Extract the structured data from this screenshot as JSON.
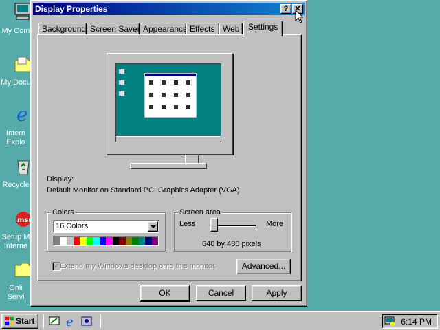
{
  "desktop": {
    "icons": [
      {
        "label": "My Com",
        "icon": "my-computer-icon"
      },
      {
        "label": "My Docu",
        "icon": "folder-icon"
      },
      {
        "label": "Intern",
        "label2": "Explo",
        "icon": "internet-explorer-icon"
      },
      {
        "label": "Recycle",
        "icon": "recycle-bin-icon"
      },
      {
        "label": "Setup M",
        "label2": "Interne",
        "icon": "msn-icon"
      },
      {
        "label": "Onli",
        "label2": "Servi",
        "icon": "folder-icon"
      }
    ]
  },
  "dialog": {
    "title": "Display Properties",
    "help_button": "?",
    "close_button": "✕",
    "tabs": [
      "Background",
      "Screen Saver",
      "Appearance",
      "Effects",
      "Web",
      "Settings"
    ],
    "active_tab": "Settings",
    "display_label": "Display:",
    "display_value": "Default Monitor on Standard PCI Graphics Adapter (VGA)",
    "colors": {
      "group_label": "Colors",
      "selected": "16 Colors",
      "palette": [
        "#808080",
        "#ffffff",
        "#c0c0c0",
        "#ff0000",
        "#ffff00",
        "#00ff00",
        "#00ffff",
        "#0000ff",
        "#ff00ff",
        "#000000",
        "#800000",
        "#808000",
        "#008000",
        "#008080",
        "#000080",
        "#800080"
      ]
    },
    "screen_area": {
      "group_label": "Screen area",
      "less_label": "Less",
      "more_label": "More",
      "resolution": "640 by 480 pixels",
      "slider_position": 0
    },
    "extend_checkbox": {
      "label": "Extend my Windows desktop onto this monitor.",
      "checked": true,
      "enabled": false
    },
    "advanced_button": "Advanced...",
    "ok_button": "OK",
    "cancel_button": "Cancel",
    "apply_button": "Apply"
  },
  "taskbar": {
    "start_label": "Start",
    "quick_launch": [
      "show-desktop-icon",
      "internet-explorer-icon",
      "channels-icon"
    ],
    "tray_icon": "display-settings-icon",
    "clock": "6:14 PM"
  }
}
